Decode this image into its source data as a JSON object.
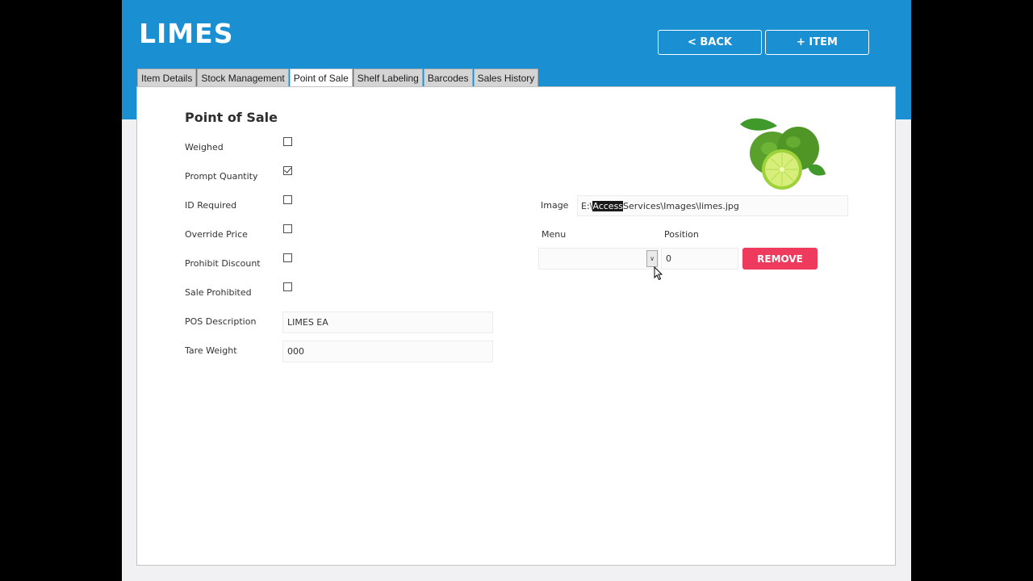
{
  "header": {
    "title": "LIMES",
    "back_label": "< BACK",
    "item_label": "+ ITEM"
  },
  "tabs": [
    {
      "label": "Item Details"
    },
    {
      "label": "Stock Management"
    },
    {
      "label": "Point of Sale",
      "active": true
    },
    {
      "label": "Shelf Labeling"
    },
    {
      "label": "Barcodes"
    },
    {
      "label": "Sales History"
    }
  ],
  "pos": {
    "section_title": "Point of Sale",
    "checkboxes": [
      {
        "label": "Weighed",
        "checked": false
      },
      {
        "label": "Prompt Quantity",
        "checked": true
      },
      {
        "label": "ID Required",
        "checked": false
      },
      {
        "label": "Override Price",
        "checked": false
      },
      {
        "label": "Prohibit Discount",
        "checked": false
      },
      {
        "label": "Sale Prohibited",
        "checked": false
      }
    ],
    "description_label": "POS Description",
    "description_value": "LIMES EA",
    "tare_label": "Tare Weight",
    "tare_value": "000"
  },
  "image": {
    "label": "Image",
    "path_prefix": "E:\\",
    "path_selected": "Access",
    "path_suffix": " Services\\Images\\limes.jpg"
  },
  "menu": {
    "label": "Menu",
    "selected": ""
  },
  "position": {
    "label": "Position",
    "value": "0"
  },
  "remove_label": "REMOVE",
  "colors": {
    "header_blue": "#1a8fd2",
    "remove_red": "#ee3a5c",
    "page_bg": "#f1f0f2"
  },
  "icons": {
    "dropdown_arrow": "chevron-down-icon",
    "cursor": "mouse-pointer-icon",
    "product_image": "lime-fruit"
  }
}
